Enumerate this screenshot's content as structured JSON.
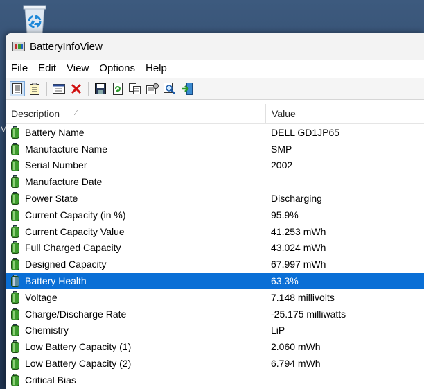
{
  "window": {
    "title": "BatteryInfoView"
  },
  "menu": [
    "File",
    "Edit",
    "View",
    "Options",
    "Help"
  ],
  "toolbar": [
    {
      "icon": "view-list-icon"
    },
    {
      "icon": "view-details-icon"
    },
    {
      "icon": "properties-window-icon"
    },
    {
      "icon": "delete-icon"
    },
    {
      "icon": "save-icon"
    },
    {
      "icon": "refresh-icon"
    },
    {
      "icon": "copy-icon"
    },
    {
      "icon": "properties-icon"
    },
    {
      "icon": "find-icon"
    },
    {
      "icon": "exit-icon"
    }
  ],
  "columns": {
    "description": "Description",
    "value": "Value"
  },
  "rows": [
    {
      "desc": "Battery Name",
      "value": "DELL GD1JP65"
    },
    {
      "desc": "Manufacture Name",
      "value": "SMP"
    },
    {
      "desc": "Serial Number",
      "value": "2002"
    },
    {
      "desc": "Manufacture Date",
      "value": ""
    },
    {
      "desc": "Power State",
      "value": "Discharging"
    },
    {
      "desc": "Current Capacity (in %)",
      "value": "95.9%"
    },
    {
      "desc": "Current Capacity Value",
      "value": "41.253 mWh"
    },
    {
      "desc": "Full Charged Capacity",
      "value": "43.024 mWh"
    },
    {
      "desc": "Designed Capacity",
      "value": "67.997 mWh"
    },
    {
      "desc": "Battery Health",
      "value": "63.3%"
    },
    {
      "desc": "Voltage",
      "value": "7.148 millivolts"
    },
    {
      "desc": "Charge/Discharge Rate",
      "value": "-25.175 milliwatts"
    },
    {
      "desc": "Chemistry",
      "value": "LiP"
    },
    {
      "desc": "Low Battery Capacity (1)",
      "value": "2.060 mWh"
    },
    {
      "desc": "Low Battery Capacity (2)",
      "value": "6.794 mWh"
    },
    {
      "desc": "Critical Bias",
      "value": ""
    }
  ],
  "selected_row": "Battery Health",
  "colors": {
    "selection": "#0a6fd6",
    "battery_green": "#3d9a2e"
  }
}
